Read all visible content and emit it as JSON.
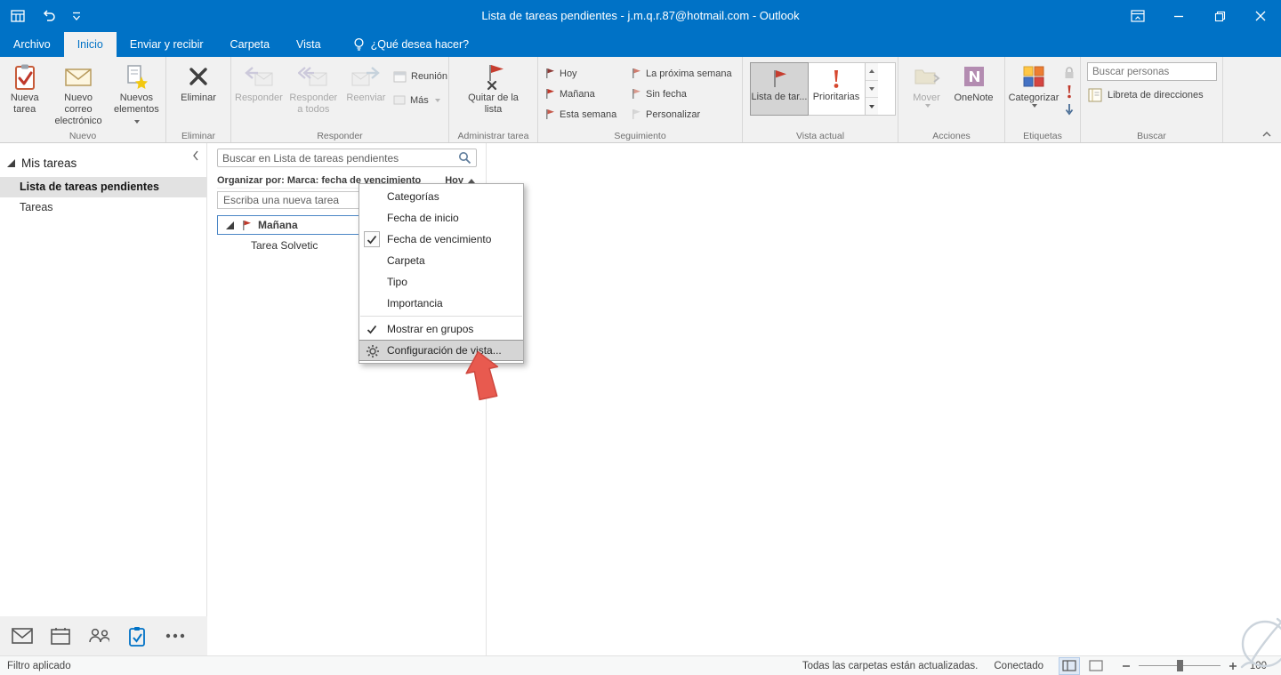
{
  "titlebar": {
    "title": "Lista de tareas pendientes - j.m.q.r.87@hotmail.com  -  Outlook"
  },
  "tabs": {
    "archivo": "Archivo",
    "inicio": "Inicio",
    "enviar": "Enviar y recibir",
    "carpeta": "Carpeta",
    "vista": "Vista",
    "ayuda": "¿Qué desea hacer?"
  },
  "ribbon": {
    "nuevo": {
      "nueva_tarea": "Nueva tarea",
      "nuevo_correo": "Nuevo correo electrónico",
      "nuevos_elementos": "Nuevos elementos",
      "label": "Nuevo"
    },
    "eliminar": {
      "button_label": "Eliminar",
      "label": "Eliminar"
    },
    "responder": {
      "responder": "Responder",
      "responder_todos": "Responder a todos",
      "reenviar": "Reenviar",
      "reunion": "Reunión",
      "mas": "Más",
      "label": "Responder"
    },
    "administrar": {
      "quitar": "Quitar de la lista",
      "label": "Administrar tarea"
    },
    "seguimiento": {
      "hoy": "Hoy",
      "manana": "Mañana",
      "esta_semana": "Esta semana",
      "proxima": "La próxima semana",
      "sin_fecha": "Sin fecha",
      "personalizar": "Personalizar",
      "label": "Seguimiento"
    },
    "vista_actual": {
      "lista": "Lista de tar...",
      "prioritarias": "Prioritarias",
      "label": "Vista actual"
    },
    "acciones": {
      "mover": "Mover",
      "onenote": "OneNote",
      "label": "Acciones"
    },
    "etiquetas": {
      "categorizar": "Categorizar",
      "label": "Etiquetas"
    },
    "buscar": {
      "placeholder": "Buscar personas",
      "libreta": "Libreta de direcciones",
      "label": "Buscar"
    }
  },
  "sidebar": {
    "header": "Mis tareas",
    "items": [
      {
        "label": "Lista de tareas pendientes",
        "selected": true
      },
      {
        "label": "Tareas",
        "selected": false
      }
    ]
  },
  "content": {
    "search_placeholder": "Buscar en Lista de tareas pendientes",
    "organize_label": "Organizar por: Marca: fecha de vencimiento",
    "organize_value": "Hoy",
    "new_task_placeholder": "Escriba una nueva tarea",
    "group_header": "Mañana",
    "task": "Tarea Solvetic"
  },
  "menu": {
    "items": [
      {
        "label": "Categorías",
        "checked": false
      },
      {
        "label": "Fecha de inicio",
        "checked": false
      },
      {
        "label": "Fecha de vencimiento",
        "checked": true
      },
      {
        "label": "Carpeta",
        "checked": false
      },
      {
        "label": "Tipo",
        "checked": false
      },
      {
        "label": "Importancia",
        "checked": false
      },
      {
        "label": "Mostrar en grupos",
        "checked": true
      },
      {
        "label": "Configuración de vista...",
        "highlighted": true
      }
    ]
  },
  "statusbar": {
    "left": "Filtro aplicado",
    "folders": "Todas las carpetas están actualizadas.",
    "connection": "Conectado",
    "zoom": "100"
  },
  "colors": {
    "titlebar_blue": "#0072C6",
    "flag_red": "#C63D2F",
    "arrow_red": "#E85A4F"
  },
  "icons": [
    "window-grid-icon",
    "undo-icon",
    "customize-qat-icon",
    "lightbulb-icon",
    "ribbon-display-options-icon",
    "minimize-icon",
    "restore-icon",
    "close-icon",
    "new-task-icon",
    "new-mail-icon",
    "new-items-icon",
    "delete-icon",
    "reply-icon",
    "reply-all-icon",
    "forward-icon",
    "meeting-icon",
    "remove-from-list-icon",
    "flag-icon",
    "priority-icon",
    "move-icon",
    "onenote-icon",
    "categorize-icon",
    "lock-icon",
    "importance-icon",
    "down-arrow-icon",
    "address-book-icon",
    "search-icon",
    "gear-icon",
    "check-icon",
    "mail-nav-icon",
    "calendar-nav-icon",
    "people-nav-icon",
    "tasks-nav-icon",
    "ellipsis-nav-icon",
    "annotation-arrow",
    "watermark-logo"
  ]
}
